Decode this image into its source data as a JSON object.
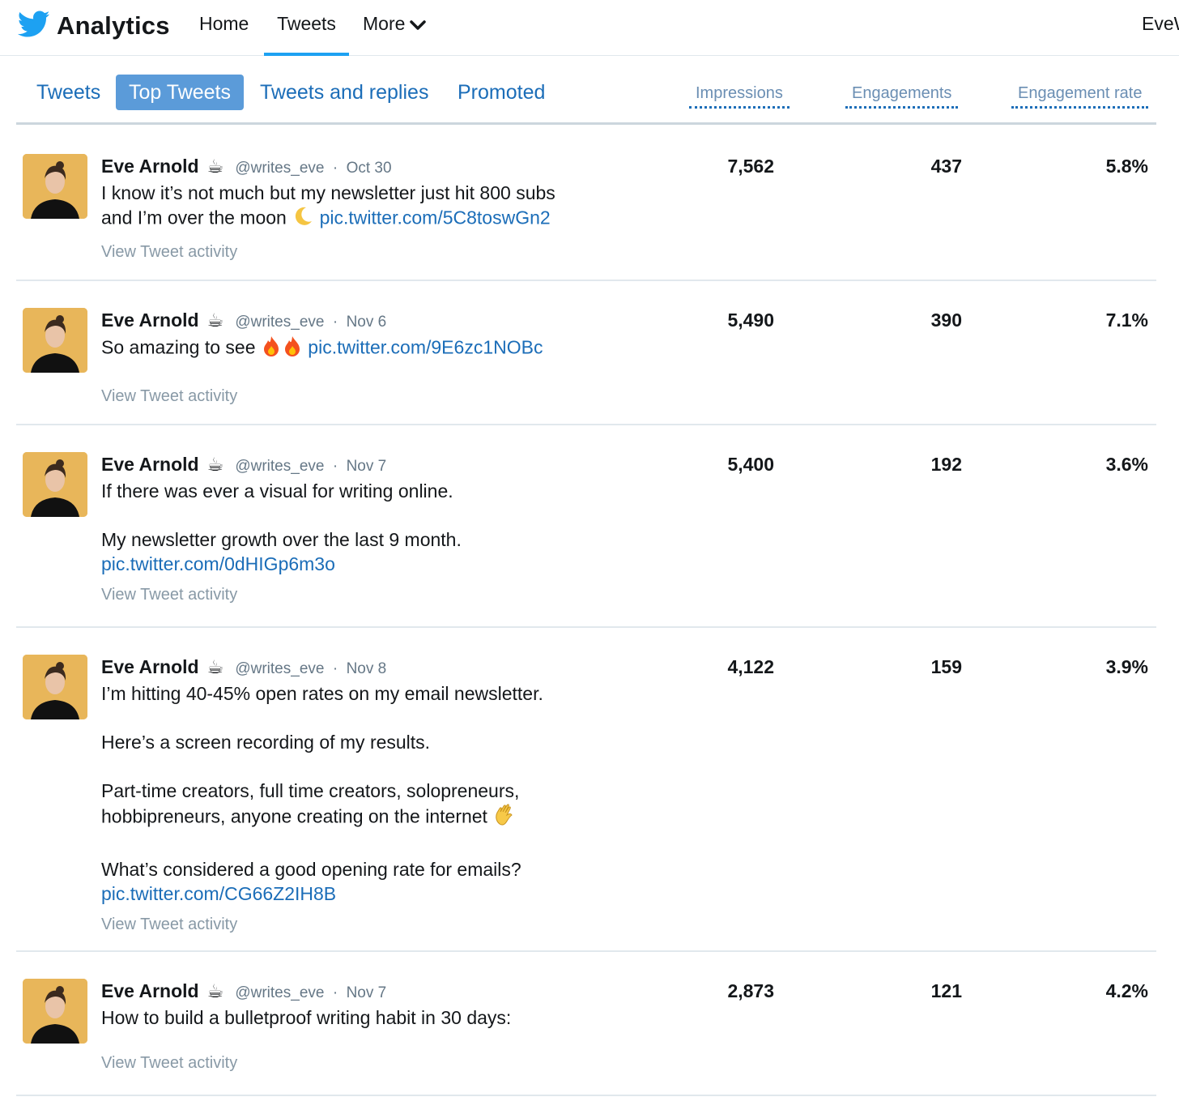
{
  "header": {
    "brand": "Analytics",
    "nav": {
      "home": "Home",
      "tweets": "Tweets",
      "more": "More"
    },
    "user": "EveW",
    "accent": "#1da1f2"
  },
  "tabs": {
    "items": [
      "Tweets",
      "Top Tweets",
      "Tweets and replies",
      "Promoted"
    ],
    "active": "Top Tweets",
    "columns": [
      "Impressions",
      "Engagements",
      "Engagement rate"
    ]
  },
  "author": {
    "name": "Eve Arnold",
    "badge": "☕",
    "handle": "@writes_eve",
    "activity_label": "View Tweet activity"
  },
  "tweets": [
    {
      "date": "Oct 30",
      "text1": "I know it’s not much but my newsletter just hit 800 subs",
      "text2": "and I’m over the moon",
      "link": "pic.twitter.com/5C8toswGn2",
      "impressions": "7,562",
      "engagements": "437",
      "rate": "5.8%"
    },
    {
      "date": "Nov 6",
      "text1": "So amazing to see",
      "link": "pic.twitter.com/9E6zc1NOBc",
      "impressions": "5,490",
      "engagements": "390",
      "rate": "7.1%"
    },
    {
      "date": "Nov 7",
      "text1": "If there was ever a visual for writing online.",
      "text2": "My newsletter growth over the last 9 month.",
      "link": "pic.twitter.com/0dHIGp6m3o",
      "impressions": "5,400",
      "engagements": "192",
      "rate": "3.6%"
    },
    {
      "date": "Nov 8",
      "text1": "I’m hitting 40-45% open rates on my email newsletter.",
      "text2": "Here’s a screen recording of my results.",
      "text3": "Part-time creators, full time creators, solopreneurs,",
      "text4": "hobbipreneurs, anyone creating on the internet",
      "text5": "What’s considered a good opening rate for emails?",
      "link": "pic.twitter.com/CG66Z2IH8B",
      "impressions": "4,122",
      "engagements": "159",
      "rate": "3.9%"
    },
    {
      "date": "Nov 7",
      "text1": "How to build a bulletproof writing habit in 30 days:",
      "impressions": "2,873",
      "engagements": "121",
      "rate": "4.2%"
    }
  ]
}
